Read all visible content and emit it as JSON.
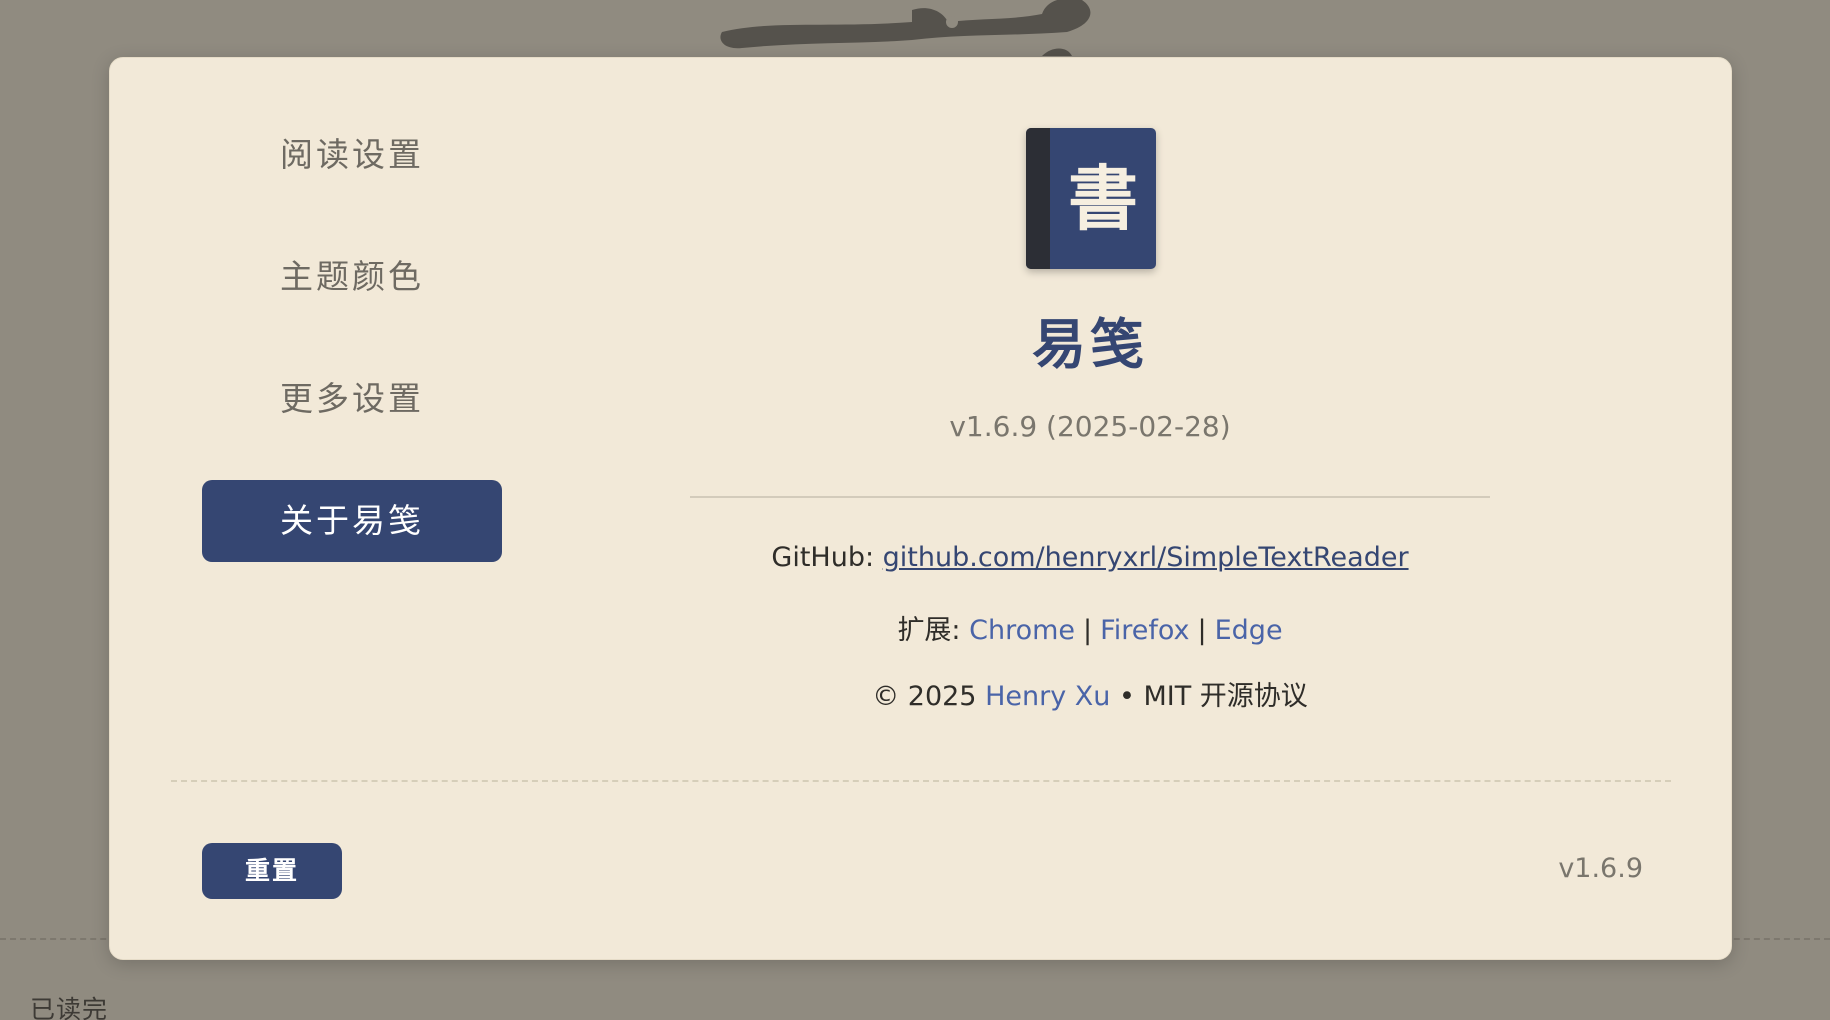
{
  "background": {
    "status_text": "已读完"
  },
  "nav": {
    "items": [
      {
        "label": "阅读设置"
      },
      {
        "label": "主题颜色"
      },
      {
        "label": "更多设置"
      },
      {
        "label": "关于易笺",
        "active": true
      }
    ]
  },
  "about": {
    "logo_char": "書",
    "app_name": "易笺",
    "version_line": "v1.6.9 (2025-02-28)",
    "github_label": "GitHub: ",
    "github_link": "github.com/henryxrl/SimpleTextReader",
    "extensions_label": "扩展: ",
    "extensions": [
      "Chrome",
      "Firefox",
      "Edge"
    ],
    "separator": "|",
    "copyright_prefix": "© 2025 ",
    "author": "Henry Xu",
    "license": " • MIT 开源协议"
  },
  "footer": {
    "reset_label": "重置",
    "version": "v1.6.9"
  },
  "colors": {
    "accent": "#354672",
    "link": "#4a64a8",
    "panel_bg": "#f2e9d8",
    "page_bg": "#908b80"
  }
}
